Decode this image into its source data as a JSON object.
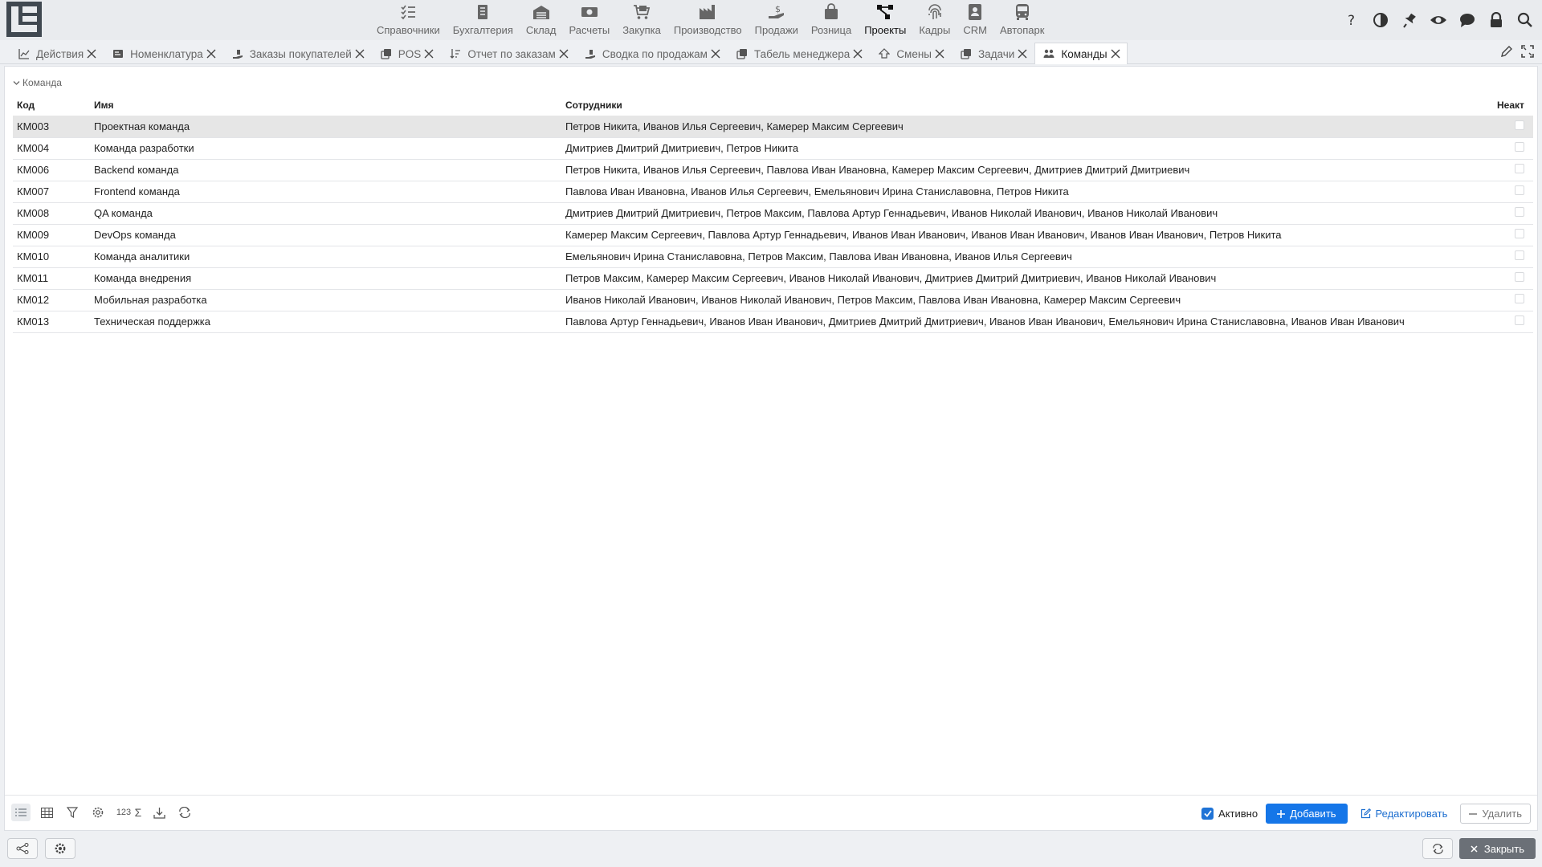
{
  "menu": {
    "items": [
      {
        "label": "Справочники"
      },
      {
        "label": "Бухгалтерия"
      },
      {
        "label": "Склад"
      },
      {
        "label": "Расчеты"
      },
      {
        "label": "Закупка"
      },
      {
        "label": "Производство"
      },
      {
        "label": "Продажи"
      },
      {
        "label": "Розница"
      },
      {
        "label": "Проекты"
      },
      {
        "label": "Кадры"
      },
      {
        "label": "CRM"
      },
      {
        "label": "Автопарк"
      }
    ],
    "active": "Проекты"
  },
  "tabs": [
    {
      "label": "Действия"
    },
    {
      "label": "Номенклатура"
    },
    {
      "label": "Заказы покупателей"
    },
    {
      "label": "POS"
    },
    {
      "label": "Отчет по заказам"
    },
    {
      "label": "Сводка по продажам"
    },
    {
      "label": "Табель менеджера"
    },
    {
      "label": "Смены"
    },
    {
      "label": "Задачи"
    },
    {
      "label": "Команды"
    }
  ],
  "active_tab": "Команды",
  "group_title": "Команда",
  "table": {
    "columns": {
      "code": "Код",
      "name": "Имя",
      "employees": "Сотрудники",
      "inactive": "Неакт"
    },
    "rows": [
      {
        "code": "КМ003",
        "name": "Проектная команда",
        "employees": "Петров Никита, Иванов Илья Сергеевич, Камерер Максим Сергеевич"
      },
      {
        "code": "КМ004",
        "name": "Команда разработки",
        "employees": "Дмитриев Дмитрий Дмитриевич, Петров Никита"
      },
      {
        "code": "КМ006",
        "name": "Backend команда",
        "employees": "Петров Никита, Иванов Илья Сергеевич, Павлова Иван Ивановна, Камерер Максим Сергеевич, Дмитриев Дмитрий Дмитриевич"
      },
      {
        "code": "КМ007",
        "name": "Frontend команда",
        "employees": "Павлова Иван Ивановна, Иванов Илья Сергеевич, Емельянович Ирина Станиславовна, Петров Никита"
      },
      {
        "code": "КМ008",
        "name": "QA команда",
        "employees": "Дмитриев Дмитрий Дмитриевич, Петров Максим, Павлова Артур Геннадьевич, Иванов Николай Иванович, Иванов Николай Иванович"
      },
      {
        "code": "КМ009",
        "name": "DevOps команда",
        "employees": "Камерер Максим Сергеевич, Павлова Артур Геннадьевич, Иванов Иван Иванович, Иванов Иван Иванович, Иванов Иван Иванович, Петров Никита"
      },
      {
        "code": "КМ010",
        "name": "Команда аналитики",
        "employees": "Емельянович Ирина Станиславовна, Петров Максим, Павлова Иван Ивановна, Иванов Илья Сергеевич"
      },
      {
        "code": "КМ011",
        "name": "Команда внедрения",
        "employees": "Петров Максим, Камерер Максим Сергеевич, Иванов Николай Иванович, Дмитриев Дмитрий Дмитриевич, Иванов Николай Иванович"
      },
      {
        "code": "КМ012",
        "name": "Мобильная разработка",
        "employees": "Иванов Николай Иванович, Иванов Николай Иванович, Петров Максим, Павлова Иван Ивановна, Камерер Максим Сергеевич"
      },
      {
        "code": "КМ013",
        "name": "Техническая поддержка",
        "employees": "Павлова Артур Геннадьевич, Иванов Иван Иванович, Дмитриев Дмитрий Дмитриевич, Иванов Иван Иванович, Емельянович Ирина Станиславовна, Иванов Иван Иванович"
      }
    ],
    "selected_row": 0
  },
  "toolbar": {
    "count_label": "123",
    "sum_label": "Σ",
    "active_label": "Активно",
    "active_checked": true,
    "add_label": "Добавить",
    "edit_label": "Редактировать",
    "delete_label": "Удалить"
  },
  "statusbar": {
    "close_label": "Закрыть"
  },
  "colors": {
    "primary": "#1576e8",
    "link": "#1e6fd0",
    "selected_row": "#e6e6e6",
    "close_button": "#6b7077"
  }
}
